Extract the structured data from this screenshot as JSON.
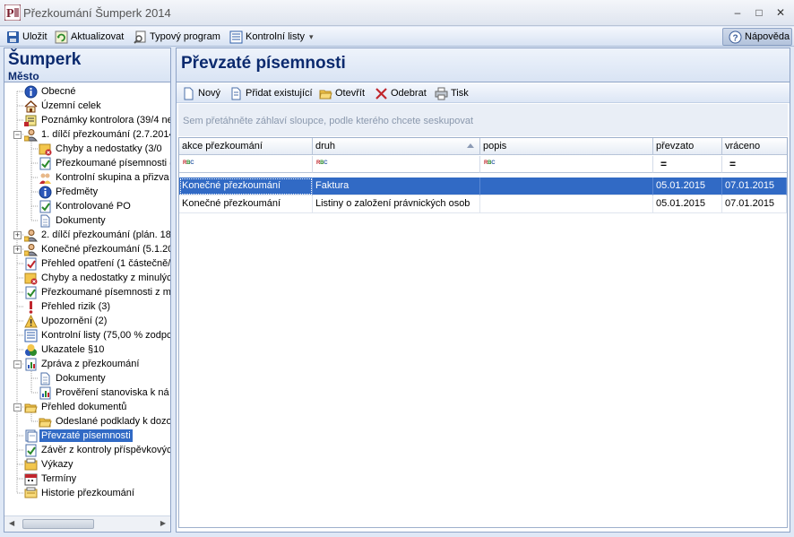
{
  "window": {
    "title": "Přezkoumání Šumperk 2014",
    "app_icon_letter": "P",
    "minimize": "–",
    "maximize": "□",
    "close": "✕"
  },
  "toolbar": {
    "save": "Uložit",
    "refresh": "Aktualizovat",
    "template": "Typový program",
    "checklists": "Kontrolní listy",
    "checklists_arrow": "▾",
    "help": "Nápověda"
  },
  "left": {
    "city": "Šumperk",
    "subject_type": "Město",
    "tree": [
      {
        "label": "Obecné",
        "icon": "info-icon"
      },
      {
        "label": "Územní celek",
        "icon": "house-icon"
      },
      {
        "label": "Poznámky kontrolora (39/4 ne",
        "icon": "notes-icon"
      },
      {
        "label": "1. dílčí přezkoumání (2.7.2014",
        "icon": "person-icon",
        "expander": "−"
      },
      {
        "label": "Chyby a nedostatky (3/0",
        "icon": "errors-icon"
      },
      {
        "label": "Přezkoumané písemnosti (",
        "icon": "check-doc-icon"
      },
      {
        "label": "Kontrolní skupina a přizva",
        "icon": "group-icon"
      },
      {
        "label": "Předměty",
        "icon": "info-icon"
      },
      {
        "label": "Kontrolované PO",
        "icon": "check-doc-icon"
      },
      {
        "label": "Dokumenty",
        "icon": "document-icon"
      },
      {
        "label": "2. dílčí přezkoumání (plán. 18.",
        "icon": "person-icon",
        "expander": "+"
      },
      {
        "label": "Konečné přezkoumání (5.1.20",
        "icon": "person-icon",
        "expander": "+"
      },
      {
        "label": "Přehled opatření (1 částečně/",
        "icon": "measures-icon"
      },
      {
        "label": "Chyby a nedostatky z minulýc",
        "icon": "errors-icon"
      },
      {
        "label": "Přezkoumané písemnosti z mir",
        "icon": "check-doc-icon"
      },
      {
        "label": "Přehled rizik (3)",
        "icon": "risk-icon"
      },
      {
        "label": "Upozornění (2)",
        "icon": "warning-icon"
      },
      {
        "label": "Kontrolní listy (75,00 % zodpc",
        "icon": "list-icon"
      },
      {
        "label": "Ukazatele §10",
        "icon": "indicators-icon"
      },
      {
        "label": "Zpráva z přezkoumání",
        "icon": "report-icon",
        "expander": "−"
      },
      {
        "label": "Dokumenty",
        "icon": "document-icon"
      },
      {
        "label": "Prověření stanoviska k ná",
        "icon": "report-icon"
      },
      {
        "label": "Přehled dokumentů",
        "icon": "folder-icon",
        "expander": "−"
      },
      {
        "label": "Odeslané podklady k dozo",
        "icon": "folder-icon"
      },
      {
        "label": "Převzaté písemnosti",
        "icon": "received-docs-icon",
        "selected": true
      },
      {
        "label": "Závěr z kontroly příspěvkovýc",
        "icon": "check-doc-icon"
      },
      {
        "label": "Výkazy",
        "icon": "statements-icon"
      },
      {
        "label": "Termíny",
        "icon": "calendar-icon"
      },
      {
        "label": "Historie přezkoumání",
        "icon": "history-icon"
      }
    ]
  },
  "main": {
    "title": "Převzaté písemnosti",
    "actions": {
      "new": "Nový",
      "add_existing": "Přidat existující",
      "open": "Otevřít",
      "remove": "Odebrat",
      "print": "Tisk"
    },
    "group_hint": "Sem přetáhněte záhlaví sloupce, podle kterého chcete seskupovat",
    "columns": [
      "akce přezkoumání",
      "druh",
      "popis",
      "převzato",
      "vráceno"
    ],
    "filter_text_glyph": "RBC",
    "filter_eq_glyph": "=",
    "rows": [
      {
        "akce": "Konečné přezkoumání",
        "druh": "Faktura",
        "popis": "",
        "prevzato": "05.01.2015",
        "vraceno": "07.01.2015",
        "selected": true
      },
      {
        "akce": "Konečné přezkoumání",
        "druh": "Listiny  o založení právnických osob",
        "popis": "",
        "prevzato": "05.01.2015",
        "vraceno": "07.01.2015"
      }
    ]
  },
  "colors": {
    "accent": "#316ac5",
    "header_text": "#0b2a6e",
    "panel_border": "#8ea3c6"
  }
}
